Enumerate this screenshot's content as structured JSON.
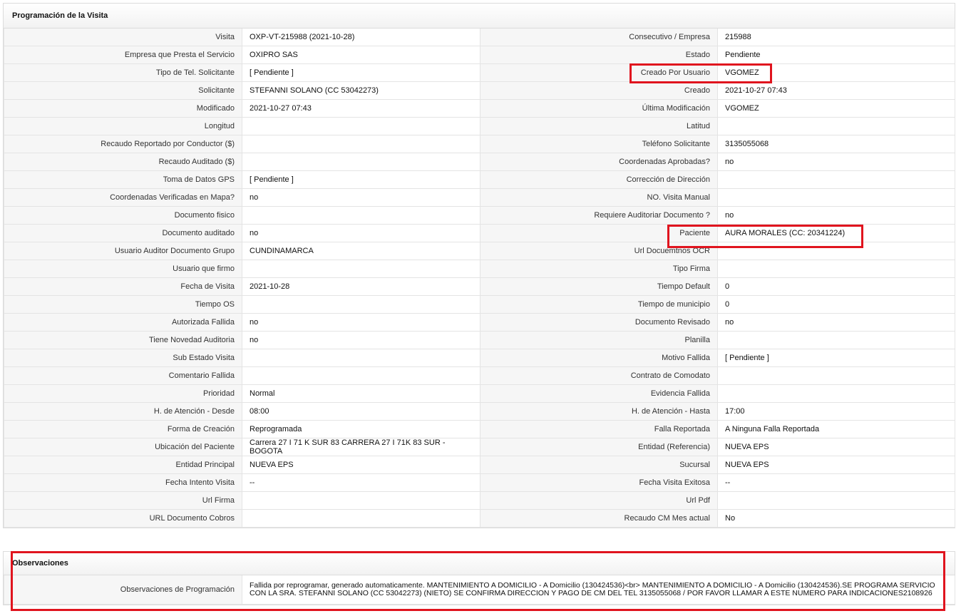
{
  "visit_section": {
    "title": "Programación de la Visita",
    "rows": [
      {
        "l1": "Visita",
        "v1": "OXP-VT-215988 (2021-10-28)",
        "l2": "Consecutivo / Empresa",
        "v2": "215988"
      },
      {
        "l1": "Empresa que Presta el Servicio",
        "v1": "OXIPRO SAS",
        "l2": "Estado",
        "v2": "Pendiente"
      },
      {
        "l1": "Tipo de Tel. Solicitante",
        "v1": "[ Pendiente ]",
        "l2": "Creado Por Usuario",
        "v2": "VGOMEZ"
      },
      {
        "l1": "Solicitante",
        "v1": "STEFANNI SOLANO (CC 53042273)",
        "l2": "Creado",
        "v2": "2021-10-27 07:43"
      },
      {
        "l1": "Modificado",
        "v1": "2021-10-27 07:43",
        "l2": "Última Modificación",
        "v2": " VGOMEZ"
      },
      {
        "l1": "Longitud",
        "v1": "",
        "l2": "Latitud",
        "v2": ""
      },
      {
        "l1": "Recaudo Reportado por Conductor ($)",
        "v1": "",
        "l2": "Teléfono Solicitante",
        "v2": "3135055068"
      },
      {
        "l1": "Recaudo Auditado ($)",
        "v1": "",
        "l2": "Coordenadas Aprobadas?",
        "v2": " no"
      },
      {
        "l1": "Toma de Datos GPS",
        "v1": "[ Pendiente ]",
        "l2": "Corrección de Dirección",
        "v2": ""
      },
      {
        "l1": "Coordenadas Verificadas en Mapa?",
        "v1": " no",
        "l2": "NO. Visita Manual",
        "v2": ""
      },
      {
        "l1": "Documento fisico",
        "v1": "",
        "l2": "Requiere Auditoriar Documento ?",
        "v2": " no"
      },
      {
        "l1": "Documento auditado",
        "v1": " no",
        "l2": "Paciente",
        "v2": "AURA MORALES (CC: 20341224)"
      },
      {
        "l1": "Usuario Auditor Documento Grupo",
        "v1": "CUNDINAMARCA",
        "l2": "Url Docuemtnos OCR",
        "v2": ""
      },
      {
        "l1": "Usuario que firmo",
        "v1": "",
        "l2": "Tipo Firma",
        "v2": ""
      },
      {
        "l1": "Fecha de Visita",
        "v1": " 2021-10-28",
        "l2": "Tiempo Default",
        "v2": "0"
      },
      {
        "l1": "Tiempo OS",
        "v1": "",
        "l2": "Tiempo de municipio",
        "v2": "0"
      },
      {
        "l1": "Autorizada Fallida",
        "v1": " no",
        "l2": "Documento Revisado",
        "v2": " no"
      },
      {
        "l1": "Tiene Novedad Auditoria",
        "v1": " no",
        "l2": "Planilla",
        "v2": ""
      },
      {
        "l1": "Sub Estado Visita",
        "v1": "",
        "l2": "Motivo Fallida",
        "v2": "[ Pendiente ]"
      },
      {
        "l1": "Comentario Fallida",
        "v1": "",
        "l2": "Contrato de Comodato",
        "v2": ""
      },
      {
        "l1": "Prioridad",
        "v1": "Normal",
        "l2": "Evidencia Fallida",
        "v2": ""
      },
      {
        "l1": "H. de Atención - Desde",
        "v1": "08:00",
        "l2": "H. de Atención - Hasta",
        "v2": "17:00"
      },
      {
        "l1": "Forma de Creación",
        "v1": "Reprogramada",
        "l2": "Falla Reportada",
        "v2": "A Ninguna Falla Reportada"
      },
      {
        "l1": "Ubicación del Paciente",
        "v1": "Carrera 27 I 71 K SUR 83 CARRERA 27 I 71K 83 SUR - BOGOTA",
        "l2": "Entidad (Referencia)",
        "v2": "NUEVA EPS"
      },
      {
        "l1": "Entidad Principal",
        "v1": "NUEVA EPS",
        "l2": "Sucursal",
        "v2": "NUEVA EPS"
      },
      {
        "l1": "Fecha Intento Visita",
        "v1": " --",
        "l2": "Fecha Visita Exitosa",
        "v2": " --"
      },
      {
        "l1": "Url Firma",
        "v1": "",
        "l2": "Url Pdf",
        "v2": ""
      },
      {
        "l1": "URL Documento Cobros",
        "v1": "",
        "l2": "Recaudo CM Mes actual",
        "v2": "No"
      }
    ]
  },
  "observations": {
    "title": "Observaciones",
    "label": "Observaciones de Programación",
    "text": "Fallida por reprogramar, generado automaticamente. MANTENIMIENTO A DOMICILIO - A Domicilio (130424536)<br> MANTENIMIENTO A DOMICILIO - A Domicilio (130424536).SE PROGRAMA SERVICIO CON LA SRA. STEFANNI SOLANO (CC 53042273) (NIETO) SE CONFIRMA DIRECCION Y PAGO DE CM DEL TEL 3135055068 / POR FAVOR LLAMAR A ESTE NUMERO PARA INDICACIONES2108926"
  },
  "colors": {
    "highlight": "#e0141e",
    "label_bg": "#f6f6f6",
    "border": "#e4e4e4"
  }
}
